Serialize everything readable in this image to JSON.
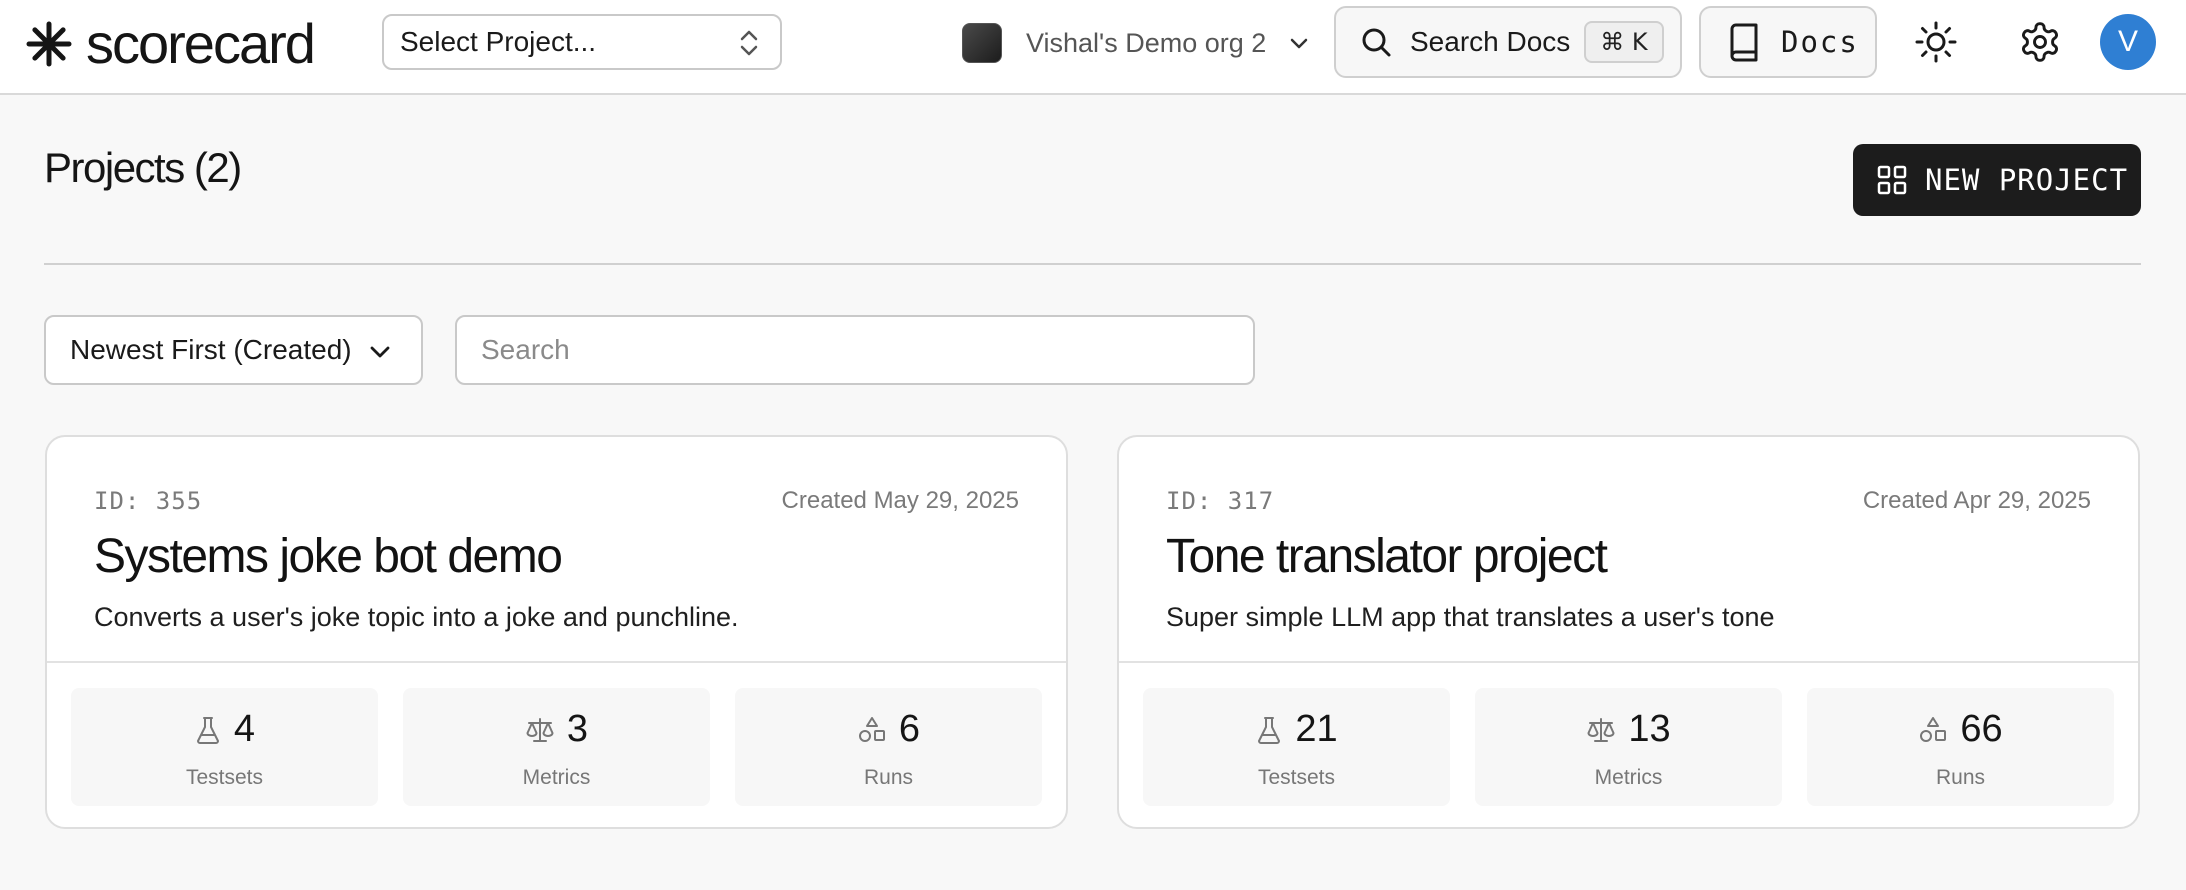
{
  "header": {
    "logo_text": "scorecard",
    "project_select_placeholder": "Select Project...",
    "org_name": "Vishal's Demo org 2",
    "search_docs_label": "Search Docs",
    "search_shortcut": "⌘ K",
    "docs_label": "Docs",
    "user_initial": "V"
  },
  "page": {
    "title": "Projects (2)",
    "new_project_label": "NEW PROJECT"
  },
  "filters": {
    "sort_value": "Newest First (Created)",
    "search_placeholder": "Search"
  },
  "projects": [
    {
      "id_label": "ID: 355",
      "created": "Created May 29, 2025",
      "title": "Systems joke bot demo",
      "description": "Converts a user's joke topic into a joke and punchline.",
      "stats": [
        {
          "icon": "flask-icon",
          "value": "4",
          "label": "Testsets"
        },
        {
          "icon": "scale-icon",
          "value": "3",
          "label": "Metrics"
        },
        {
          "icon": "shapes-icon",
          "value": "6",
          "label": "Runs"
        }
      ]
    },
    {
      "id_label": "ID: 317",
      "created": "Created Apr 29, 2025",
      "title": "Tone translator project",
      "description": "Super simple LLM app that translates a user's tone",
      "stats": [
        {
          "icon": "flask-icon",
          "value": "21",
          "label": "Testsets"
        },
        {
          "icon": "scale-icon",
          "value": "13",
          "label": "Metrics"
        },
        {
          "icon": "shapes-icon",
          "value": "66",
          "label": "Runs"
        }
      ]
    }
  ],
  "colors": {
    "accent_dark": "#1c1c1c",
    "avatar_blue": "#2f7fd3",
    "background": "#f8f8f8"
  }
}
